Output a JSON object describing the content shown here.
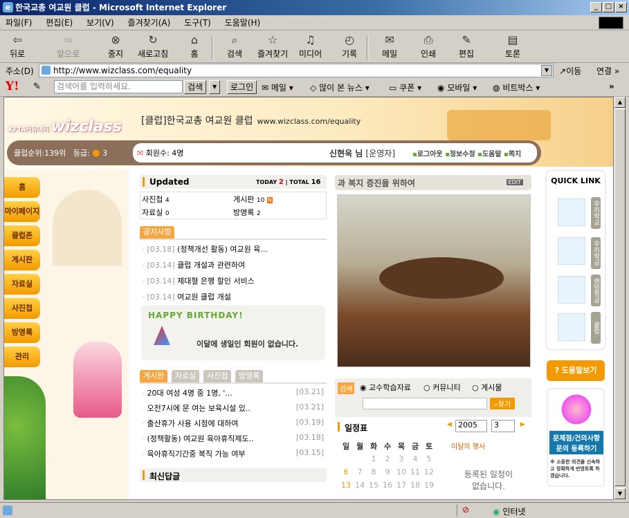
{
  "window": {
    "title": "한국교총 여교원 클럽 - Microsoft Internet Explorer",
    "min": "_",
    "max": "□",
    "close": "×"
  },
  "menu": [
    "파일(F)",
    "편집(E)",
    "보기(V)",
    "즐겨찾기(A)",
    "도구(T)",
    "도움말(H)"
  ],
  "toolbar": {
    "back": "뒤로",
    "forward": "앞으로",
    "stop": "중지",
    "refresh": "새로고침",
    "home": "홈",
    "search": "검색",
    "favorites": "즐겨찾기",
    "media": "미디어",
    "history": "기록",
    "mail": "메일",
    "print": "인쇄",
    "edit": "편집",
    "discuss": "토론"
  },
  "address": {
    "label": "주소(D)",
    "url": "http://www.wizclass.com/equality",
    "go": "이동",
    "links": "연결 »"
  },
  "yahoo": {
    "placeholder": "검색어를 입력하세요.",
    "search": "검색",
    "login": "로그인",
    "mail": "메일",
    "news": "많이 본 뉴스",
    "coupon": "쿠폰",
    "mobile": "모바일",
    "bitbox": "비트박스",
    "more": "»"
  },
  "site": {
    "logo_prefix": "KFTA커뮤니티",
    "logo": "wizclass",
    "club_name": "[클럽]한국교총 여교원 클럽",
    "club_url": "www.wizclass.com/equality",
    "rank_label": "클럽순위:139위",
    "grade_label": "등급:",
    "grade_value": "3",
    "members": "회원수: 4명",
    "user": "신현욱 님",
    "role": "[운영자]",
    "user_links": [
      "로그아웃",
      "정보수정",
      "도움말",
      "쪽지"
    ],
    "nav": [
      "홈",
      "마이페이지",
      "클럽존",
      "게시판",
      "자료실",
      "사진첩",
      "방명록",
      "관리"
    ],
    "updated": {
      "title": "Updated",
      "today_label": "TODAY",
      "today": "2",
      "total_label": "TOTAL",
      "total": "16",
      "items": [
        {
          "name": "사진첩",
          "count": "4"
        },
        {
          "name": "게시판",
          "count": "10"
        },
        {
          "name": "자료실",
          "count": "0"
        },
        {
          "name": "방명록",
          "count": "2"
        }
      ],
      "new_badge": "N"
    },
    "notice": {
      "title": "공지사항",
      "items": [
        {
          "date": "[03.18]",
          "text": "(정책개선 활동) 여교원 육..."
        },
        {
          "date": "[03.14]",
          "text": "클럽 개설과 관련하여"
        },
        {
          "date": "[03.14]",
          "text": "제대혈 은행 할인 서비스"
        },
        {
          "date": "[03.14]",
          "text": "여교원 클럽 개설"
        }
      ]
    },
    "birthday": {
      "title": "HAPPY BIRTHDAY!",
      "message": "이달에 생일인 회원이 없습니다."
    },
    "board": {
      "tabs": [
        "게시판",
        "자료실",
        "사진첩",
        "방명록"
      ],
      "items": [
        {
          "text": "20대 여성 4명 중 1명, '...",
          "date": "[03.21]"
        },
        {
          "text": "오전7시에 문 여는 보육시설 있..",
          "date": "[03.21]"
        },
        {
          "text": "출산휴가 사용 시점에 대하여",
          "date": "[03.19]"
        },
        {
          "text": "(정책활동) 여교원 육아휴직제도..",
          "date": "[03.18]"
        },
        {
          "text": "육아휴직기간중 복직 가능 여부",
          "date": "[03.15]"
        }
      ],
      "reply_title": "최신답글"
    },
    "banner": {
      "text": "과 복지 증진을 위하여",
      "edit": "EDIT"
    },
    "search": {
      "label": "검색",
      "options": [
        "교수학습자료",
        "커뮤니티",
        "게시물"
      ],
      "button": "찾기"
    },
    "calendar": {
      "title": "일정표",
      "year": "2005",
      "month": "3",
      "days": [
        "일",
        "월",
        "화",
        "수",
        "목",
        "금",
        "토"
      ],
      "weeks": [
        [
          "",
          "",
          "1",
          "2",
          "3",
          "4",
          "5"
        ],
        [
          "6",
          "7",
          "8",
          "9",
          "10",
          "11",
          "12"
        ],
        [
          "13",
          "14",
          "15",
          "16",
          "17",
          "18",
          "19"
        ]
      ],
      "events_title": "이달의 행사",
      "events_empty": "등록된 일정이 없습니다."
    },
    "quicklink": {
      "title": "QUICK LINK",
      "items": [
        "우리학교",
        "우리학급",
        "랜덤학급",
        "클럽"
      ]
    },
    "help": {
      "button": "도움말보기",
      "notice": "문제점/건의사항 문의 등록하기",
      "sub": "※ 소중한 의견을 신속하고 정확하게 반영토록 하겠습니다."
    }
  },
  "status": {
    "zone": "인터넷"
  },
  "colors": {
    "accent": "#f29a00",
    "titlebar": "#0a246a",
    "brown": "#8b6f5a"
  }
}
